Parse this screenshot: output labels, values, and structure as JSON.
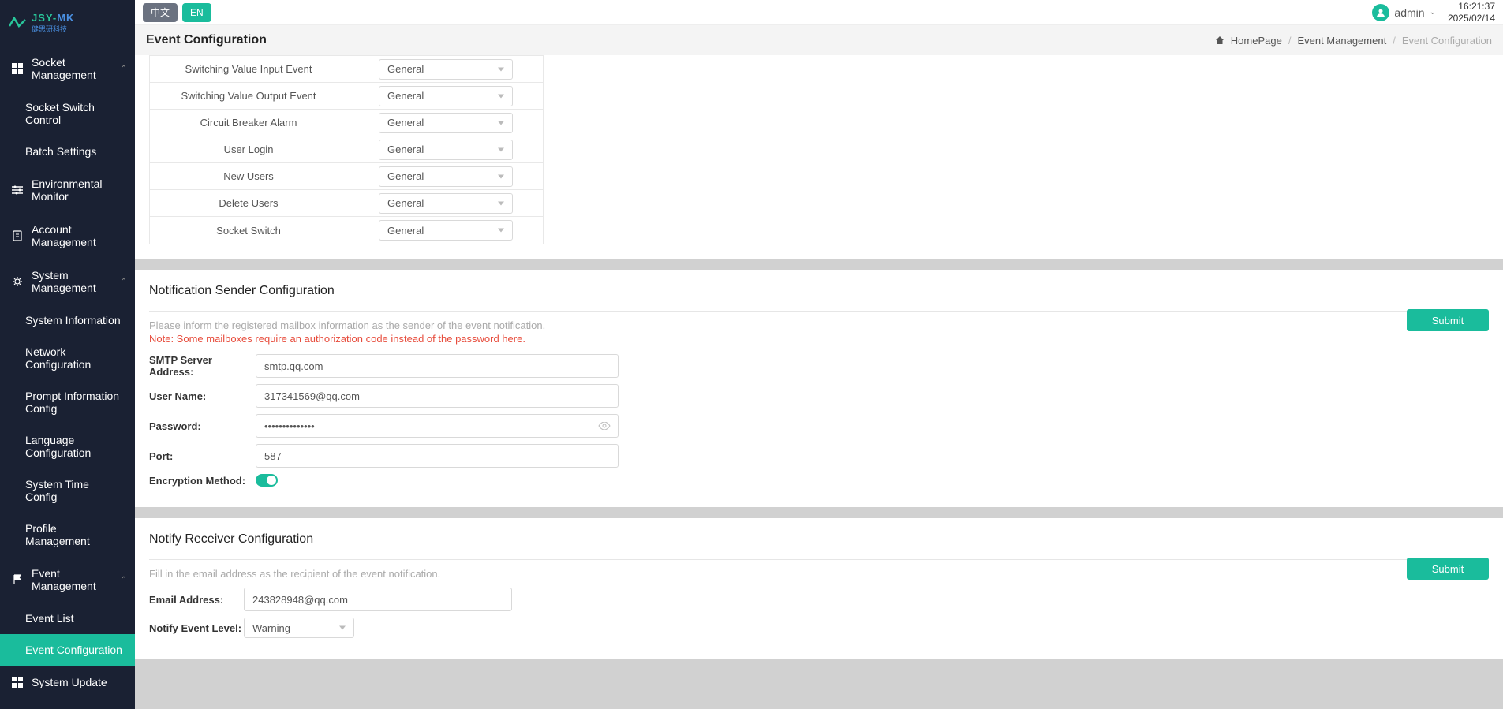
{
  "logo": {
    "brand_top": "JSY-",
    "brand_top2": "MK",
    "brand_sub": "健思研科技"
  },
  "lang": {
    "zh": "中文",
    "en": "EN"
  },
  "user": {
    "name": "admin"
  },
  "datetime": {
    "time": "16:21:37",
    "date": "2025/02/14"
  },
  "page": {
    "title": "Event Configuration"
  },
  "breadcrumb": {
    "home": "HomePage",
    "l1": "Event Management",
    "l2": "Event Configuration"
  },
  "sidebar": {
    "items": [
      {
        "label": "Socket Management",
        "icon": "grid",
        "expand": true
      },
      {
        "label": "Environmental Monitor",
        "icon": "sliders"
      },
      {
        "label": "Account Management",
        "icon": "clipboard"
      },
      {
        "label": "System Management",
        "icon": "gear",
        "expand": true
      },
      {
        "label": "Event Management",
        "icon": "flag",
        "expand": true
      },
      {
        "label": "System Update",
        "icon": "grid"
      }
    ],
    "socket_sub": [
      {
        "label": "Socket Switch Control"
      },
      {
        "label": "Batch Settings"
      }
    ],
    "system_sub": [
      {
        "label": "System Information"
      },
      {
        "label": "Network Configuration"
      },
      {
        "label": "Prompt Information Config"
      },
      {
        "label": "Language Configuration"
      },
      {
        "label": "System Time Config"
      },
      {
        "label": "Profile Management"
      }
    ],
    "event_sub": [
      {
        "label": "Event List"
      },
      {
        "label": "Event Configuration",
        "active": true
      }
    ]
  },
  "event_rows": [
    {
      "label": "Switching Value Input Event",
      "value": "General"
    },
    {
      "label": "Switching Value Output Event",
      "value": "General"
    },
    {
      "label": "Circuit Breaker Alarm",
      "value": "General"
    },
    {
      "label": "User Login",
      "value": "General"
    },
    {
      "label": "New Users",
      "value": "General"
    },
    {
      "label": "Delete Users",
      "value": "General"
    },
    {
      "label": "Socket Switch",
      "value": "General"
    }
  ],
  "sender": {
    "title": "Notification Sender Configuration",
    "hint": "Please inform the registered mailbox information as the sender of the event notification.",
    "note": "Note: Some mailboxes require an authorization code instead of the password here.",
    "smtp_label": "SMTP Server Address:",
    "smtp_value": "smtp.qq.com",
    "user_label": "User Name:",
    "user_value": "317341569@qq.com",
    "pwd_label": "Password:",
    "pwd_value": "••••••••••••••",
    "port_label": "Port:",
    "port_value": "587",
    "enc_label": "Encryption Method:",
    "submit": "Submit"
  },
  "receiver": {
    "title": "Notify Receiver Configuration",
    "hint": "Fill in the email address as the recipient of the event notification.",
    "email_label": "Email Address:",
    "email_value": "243828948@qq.com",
    "level_label": "Notify Event Level:",
    "level_value": "Warning",
    "submit": "Submit"
  }
}
